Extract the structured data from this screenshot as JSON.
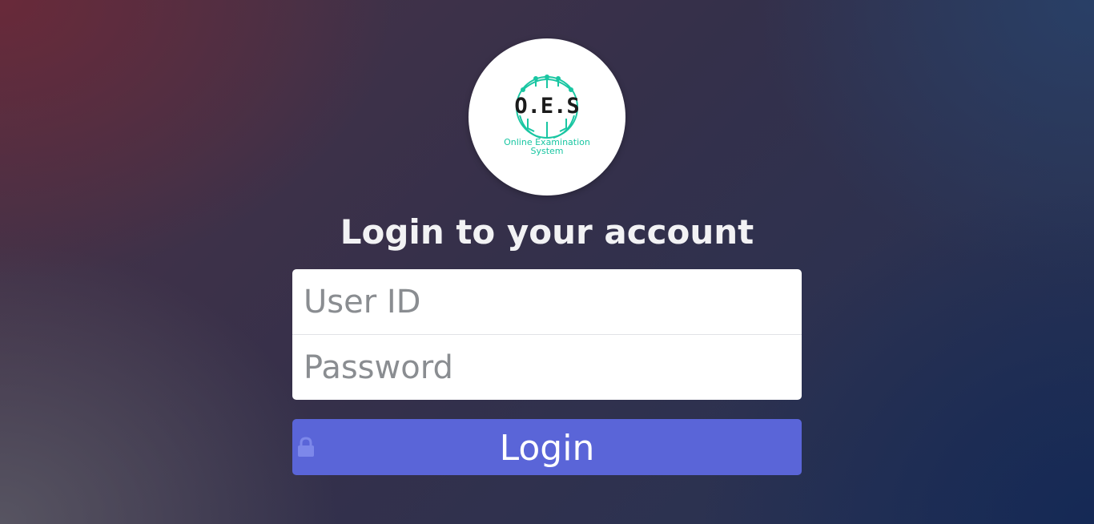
{
  "logo": {
    "title": "O.E.S",
    "subtitle_line1": "Online Examination",
    "subtitle_line2": "System"
  },
  "heading": "Login to your account",
  "form": {
    "user_id_placeholder": "User ID",
    "user_id_value": "",
    "password_placeholder": "Password",
    "password_value": ""
  },
  "login_button": {
    "label": "Login",
    "icon": "lock-icon"
  },
  "colors": {
    "button": "#5a65d8",
    "logo_accent": "#19c6a2",
    "heading": "#f2f2f4"
  }
}
